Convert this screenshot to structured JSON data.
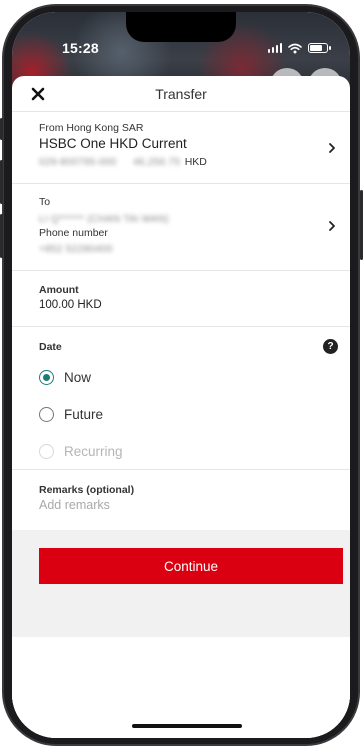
{
  "status_bar": {
    "time": "15:28"
  },
  "nav": {
    "title": "Transfer"
  },
  "from_account": {
    "label": "From Hong Kong SAR",
    "account_name": "HSBC One HKD Current",
    "account_number_masked": "029-800795-000",
    "balance_masked": "46,256.75",
    "currency": "HKD"
  },
  "to": {
    "label": "To",
    "recipient_masked": "LI Q****** (CHAN TAI MAN)",
    "method_label": "Phone number",
    "phone_masked": "+852 52280400"
  },
  "amount": {
    "label": "Amount",
    "value": "100.00 HKD"
  },
  "date": {
    "label": "Date",
    "help": "?",
    "options": [
      {
        "label": "Now",
        "selected": true,
        "disabled": false
      },
      {
        "label": "Future",
        "selected": false,
        "disabled": false
      },
      {
        "label": "Recurring",
        "selected": false,
        "disabled": true
      }
    ]
  },
  "remarks": {
    "label": "Remarks (optional)",
    "placeholder": "Add remarks",
    "value": ""
  },
  "actions": {
    "continue_label": "Continue"
  },
  "colors": {
    "brand_red": "#db0011",
    "radio_selected": "#1b7c74",
    "footer_bg": "#f1f1f1"
  }
}
